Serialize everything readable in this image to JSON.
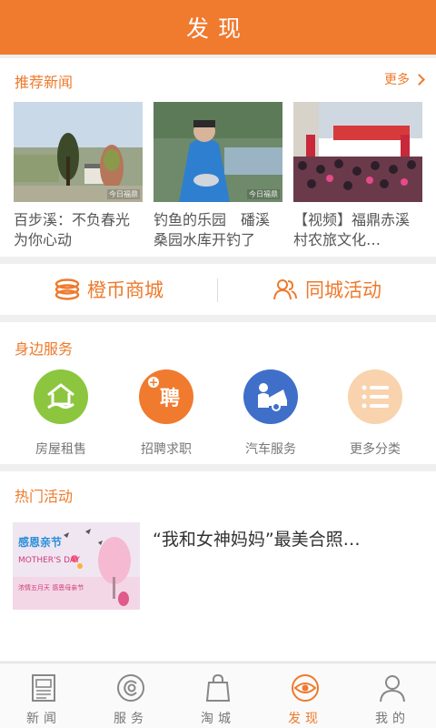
{
  "header": {
    "title": "发现"
  },
  "news": {
    "section_title": "推荐新闻",
    "more_label": "更多",
    "items": [
      {
        "caption": "百步溪：不负春光 为你心动",
        "watermark": "今日福鼎"
      },
      {
        "caption": "钓鱼的乐园　磻溪桑园水库开钓了",
        "watermark": "今日福鼎"
      },
      {
        "caption": "【视频】福鼎赤溪村农旅文化…",
        "watermark": ""
      }
    ]
  },
  "quick_links": [
    {
      "label": "橙币商城",
      "icon": "coins-icon"
    },
    {
      "label": "同城活动",
      "icon": "people-icon"
    }
  ],
  "services": {
    "section_title": "身边服务",
    "items": [
      {
        "label": "房屋租售",
        "icon": "house-icon",
        "color": "#8cc63f"
      },
      {
        "label": "招聘求职",
        "icon": "recruit-icon",
        "color": "#f07a2e",
        "glyph": "聘"
      },
      {
        "label": "汽车服务",
        "icon": "car-service-icon",
        "color": "#3f6fc9"
      },
      {
        "label": "更多分类",
        "icon": "list-icon",
        "color": "#f8d3ad"
      }
    ]
  },
  "hot": {
    "section_title": "热门活动",
    "items": [
      {
        "title": "“我和女神妈妈”最美合照…",
        "poster_title": "感恩亲节",
        "poster_en": "MOTHER'S DAY",
        "poster_sub": "浓情五月天 感恩母亲节"
      }
    ]
  },
  "tabs": [
    {
      "label": "新闻",
      "icon": "newspaper-icon",
      "active": false
    },
    {
      "label": "服务",
      "icon": "service-icon",
      "active": false
    },
    {
      "label": "淘城",
      "icon": "shopping-bag-icon",
      "active": false
    },
    {
      "label": "发现",
      "icon": "eye-icon",
      "active": true
    },
    {
      "label": "我的",
      "icon": "user-icon",
      "active": false
    }
  ],
  "colors": {
    "accent": "#f07a2e"
  }
}
